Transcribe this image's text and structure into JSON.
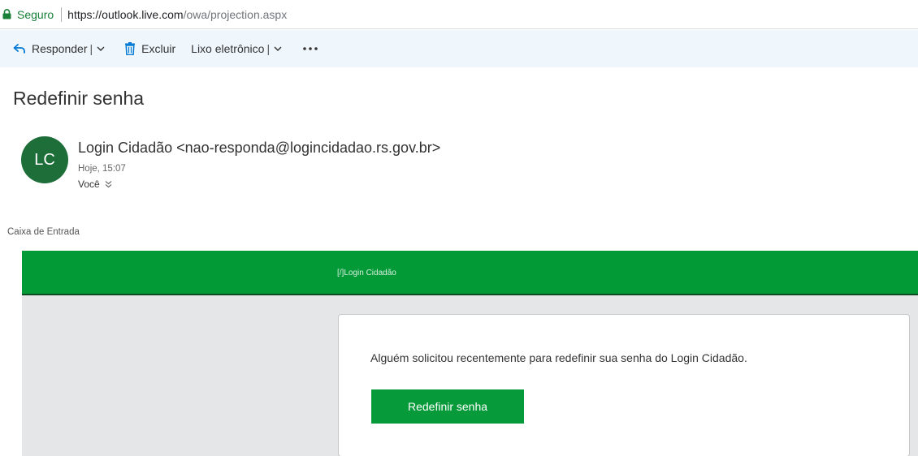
{
  "address_bar": {
    "secure_label": "Seguro",
    "url_host": "https://outlook.live.com",
    "url_path": "/owa/projection.aspx",
    "lock_icon": "lock-icon",
    "secure_color": "#188038"
  },
  "toolbar": {
    "reply_label": "Responder",
    "delete_label": "Excluir",
    "junk_label": "Lixo eletrônico",
    "separator": "|",
    "more_icon": "more-icon",
    "background": "#eff6fc",
    "accent": "#0078d4"
  },
  "message": {
    "subject": "Redefinir senha",
    "avatar_initials": "LC",
    "avatar_color": "#1e6e3a",
    "sender": "Login Cidadão <nao-responda@logincidadao.rs.gov.br>",
    "sent_time": "Hoje, 15:07",
    "recipient": "Você",
    "folder": "Caixa de Entrada"
  },
  "email_content": {
    "brand_text": "[/]Login Cidadão",
    "brand_color": "#029a37",
    "message_text": "Alguém solicitou recentemente para redefinir sua senha do Login Cidadão.",
    "button_label": "Redefinir senha",
    "button_color": "#079a3a"
  }
}
